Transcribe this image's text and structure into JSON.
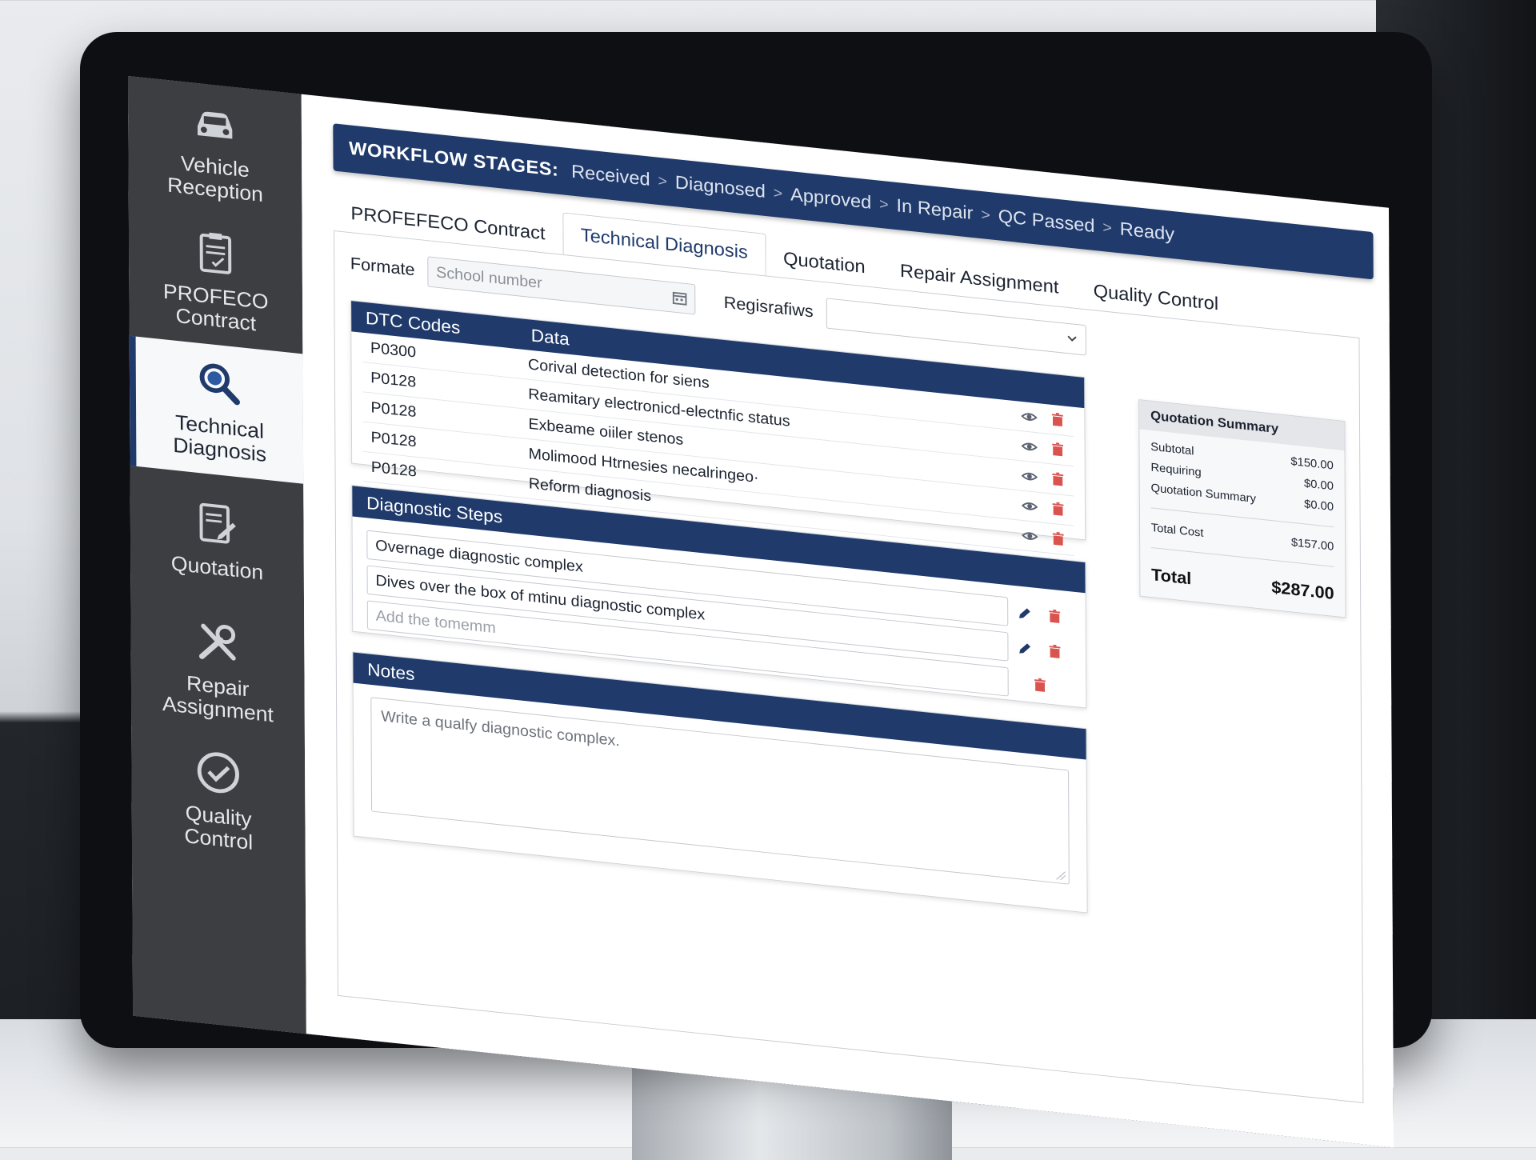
{
  "sidebar": {
    "items": [
      {
        "label": "Vehicle\nReception",
        "icon": "car-icon"
      },
      {
        "label": "PROFECO\nContract",
        "icon": "clipboard-icon"
      },
      {
        "label": "Technical\nDiagnosis",
        "icon": "magnifier-icon"
      },
      {
        "label": "Quotation",
        "icon": "document-edit-icon"
      },
      {
        "label": "Repair\nAssignment",
        "icon": "tools-icon"
      },
      {
        "label": "Quality\nControl",
        "icon": "check-circle-icon"
      }
    ],
    "active_index": 2
  },
  "workflow": {
    "title": "WORKFLOW STAGES:",
    "stages": [
      "Received",
      "Diagnosed",
      "Approved",
      "In Repair",
      "QC Passed",
      "Ready"
    ],
    "separator": ">"
  },
  "tabs": [
    {
      "label": "PROFEFECO Contract",
      "active": false
    },
    {
      "label": "Technical Diagnosis",
      "active": true
    },
    {
      "label": "Quotation",
      "active": false
    },
    {
      "label": "Repair Assignment",
      "active": false
    },
    {
      "label": "Quality Control",
      "active": false
    }
  ],
  "form": {
    "formate_label": "Formate",
    "school_placeholder": "School number",
    "registration_label": "Regisrafiws",
    "registration_value": ""
  },
  "dtc": {
    "col_code": "DTC Codes",
    "col_data": "Data",
    "rows": [
      {
        "code": "P0300",
        "data": "Corival detection for siens"
      },
      {
        "code": "P0128",
        "data": "Reamitary electronicd-electnfic status"
      },
      {
        "code": "P0128",
        "data": "Exbeame oiiler stenos"
      },
      {
        "code": "P0128",
        "data": "Molimood Htrnesies necalringeo·"
      },
      {
        "code": "P0128",
        "data": "Reform diagnosis"
      }
    ]
  },
  "steps": {
    "title": "Diagnostic Steps",
    "items": [
      "Overnage diagnostic complex",
      "Dives over the box of mtinu diagnostic complex"
    ],
    "add_placeholder": "Add the tomemm"
  },
  "notes": {
    "title": "Notes",
    "placeholder": "Write a qualfy diagnostic complex."
  },
  "summary": {
    "title": "Quotation Summary",
    "rows": [
      {
        "label": "Subtotal",
        "value": "$150.00"
      },
      {
        "label": "Requiring",
        "value": "$0.00"
      },
      {
        "label": "Quotation Summary",
        "value": "$0.00"
      }
    ],
    "total_cost_label": "Total Cost",
    "total_cost_value": "$157.00",
    "total_label": "Total",
    "total_value": "$287.00"
  },
  "colors": {
    "primary": "#1f3a6b",
    "sidebar": "#3c3e42",
    "delete": "#d9534f"
  }
}
